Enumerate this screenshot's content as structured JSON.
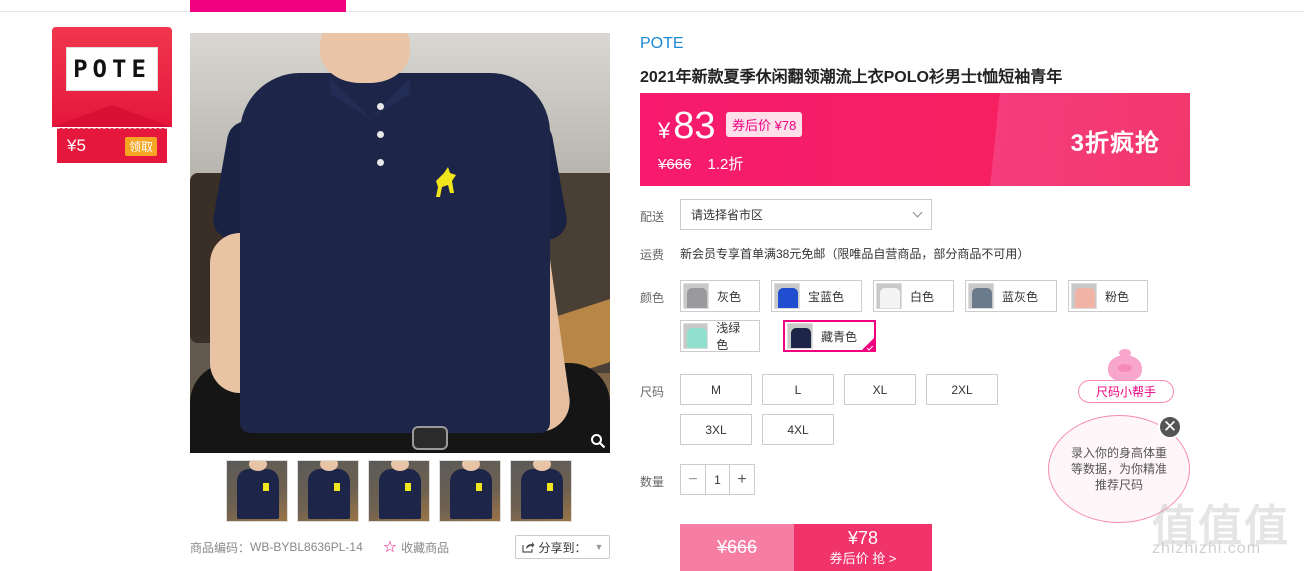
{
  "brand_card": {
    "logo_text": "POTE",
    "coupon_value": "¥5",
    "coupon_button": "领取"
  },
  "gallery": {
    "thumbnails": 5
  },
  "sku_row": {
    "code_label": "商品编码：",
    "code_value": "WB-BYBL8636PL-14",
    "favorite_label": "收藏商品",
    "share_label": "分享到："
  },
  "product": {
    "brand": "POTE",
    "title": "2021年新款夏季休闲翻领潮流上衣POLO衫男士t恤短袖青年"
  },
  "price": {
    "currency": "¥",
    "current": "83",
    "coupon_price": "券后价 ¥78",
    "original": "¥666",
    "discount": "1.2折",
    "promo": "3折疯抢"
  },
  "delivery": {
    "label": "配送",
    "region_placeholder": "请选择省市区"
  },
  "shipping": {
    "label": "运费",
    "text": "新会员专享首单满38元免邮（限唯品自营商品，部分商品不可用）"
  },
  "colors": {
    "label": "颜色",
    "options": [
      {
        "name": "灰色",
        "swatch": "#9a9a9e"
      },
      {
        "name": "宝蓝色",
        "swatch": "#1f4fd0"
      },
      {
        "name": "白色",
        "swatch": "#f4f4f4"
      },
      {
        "name": "蓝灰色",
        "swatch": "#6c7b8c"
      },
      {
        "name": "粉色",
        "swatch": "#f0b3a6"
      },
      {
        "name": "浅绿色",
        "swatch": "#8fe0cf"
      },
      {
        "name": "藏青色",
        "swatch": "#1d2548"
      }
    ],
    "selected": "藏青色"
  },
  "sizes": {
    "label": "尺码",
    "options": [
      "M",
      "L",
      "XL",
      "2XL",
      "3XL",
      "4XL"
    ]
  },
  "quantity": {
    "label": "数量",
    "minus": "−",
    "value": "1",
    "plus": "+"
  },
  "buy": {
    "original_price": "¥666",
    "coupon_price": "¥78",
    "action": "券后价 抢 >"
  },
  "size_helper": {
    "tag": "尺码小帮手",
    "message": "录入你的身高体重等数据，为你精准推荐尺码",
    "close": "✕"
  },
  "watermark": {
    "big": "值值值",
    "small": "zhizhizhi.com"
  },
  "colors_theme": {
    "accent": "#f10180",
    "price_banner": "#f71a6e",
    "link_blue": "#1a8ad4"
  }
}
